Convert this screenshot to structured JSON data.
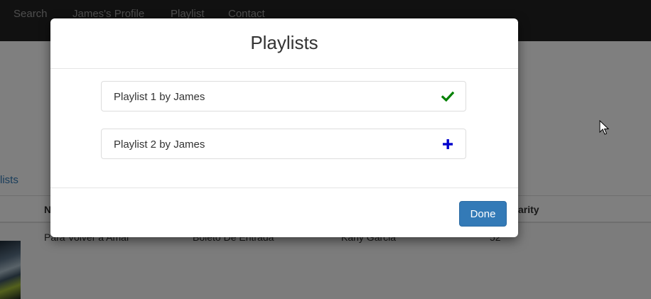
{
  "navbar": {
    "links": [
      {
        "label": "Search"
      },
      {
        "label": "James's Profile"
      },
      {
        "label": "Playlist"
      },
      {
        "label": "Contact"
      }
    ]
  },
  "page": {
    "tab_label": "lists",
    "table": {
      "headers": [
        "N",
        "arity"
      ],
      "row": {
        "name": "Para Volver a Amar",
        "album": "Boleto De Entrada",
        "artist": "Kany Garcia",
        "popularity": "52"
      }
    }
  },
  "modal": {
    "title": "Playlists",
    "items": [
      {
        "label": "Playlist 1 by James",
        "status": "added",
        "icon": "check-icon",
        "icon_color": "#008000"
      },
      {
        "label": "Playlist 2 by James",
        "status": "not-added",
        "icon": "plus-icon",
        "icon_color": "#0000cc"
      }
    ],
    "done_label": "Done"
  },
  "colors": {
    "navbar_bg": "#222222",
    "primary": "#337ab7",
    "link": "#337ab7"
  }
}
